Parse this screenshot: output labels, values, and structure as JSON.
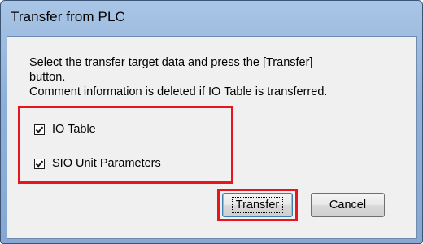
{
  "window": {
    "title": "Transfer from PLC"
  },
  "message": {
    "line1": "Select the transfer target data and press the [Transfer]",
    "line2": "button.",
    "line3": "Comment information is deleted if IO Table is transferred."
  },
  "options": [
    {
      "label": "IO Table",
      "checked": true
    },
    {
      "label": "SIO Unit Parameters",
      "checked": true
    }
  ],
  "buttons": {
    "transfer_label": "Transfer",
    "cancel_label": "Cancel"
  },
  "colors": {
    "highlight": "#e8141e",
    "titlebar": "#a9c5e6",
    "client_bg": "#f0f0f0"
  }
}
